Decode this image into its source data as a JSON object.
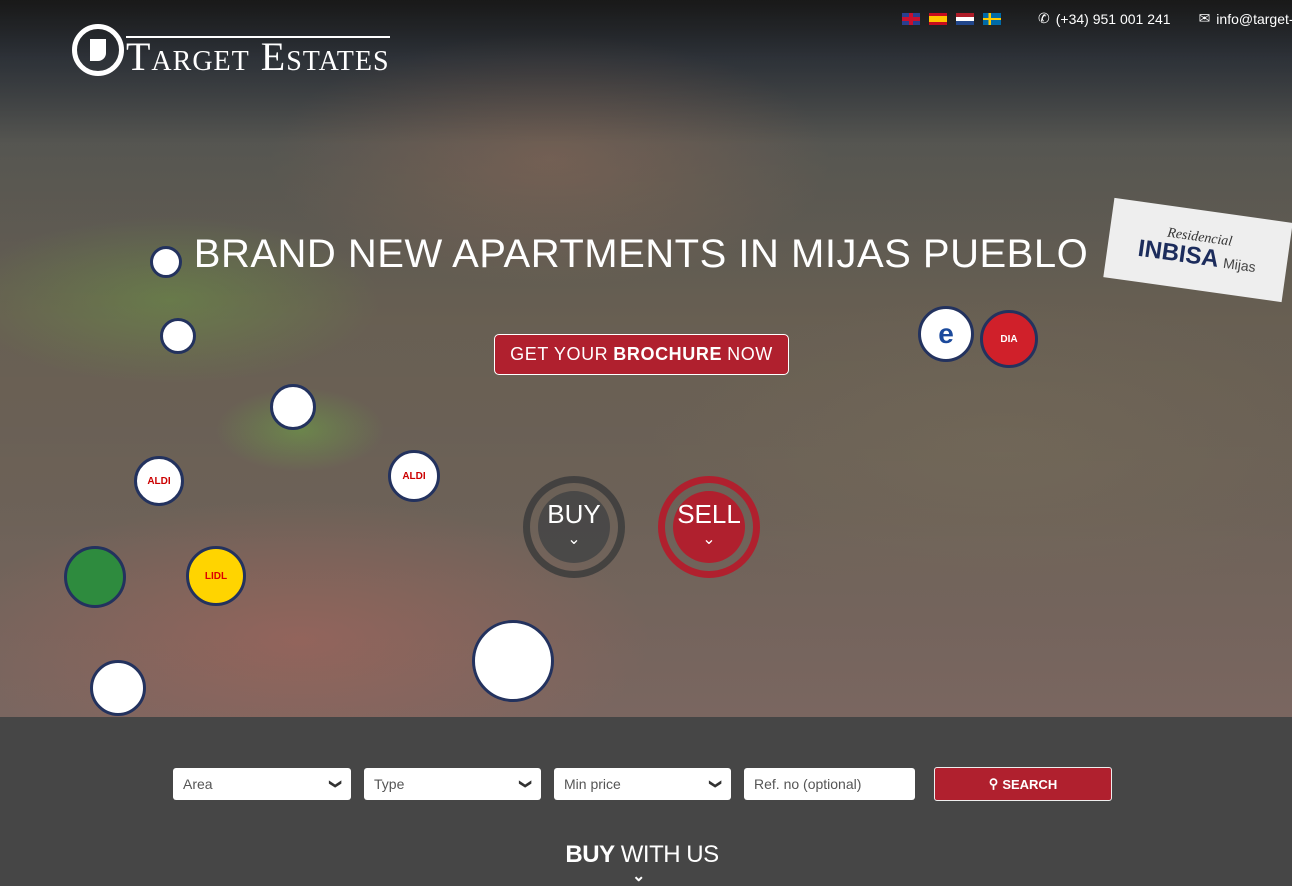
{
  "brand": {
    "name": "Target Estates"
  },
  "topbar": {
    "languages": [
      "English",
      "Español",
      "Nederlands",
      "Svenska"
    ],
    "phone": "(+34) 951 001 241",
    "email": "info@target-"
  },
  "hero": {
    "headline": "BRAND NEW APARTMENTS IN MIJAS PUEBLO",
    "cta": {
      "pre": "GET YOUR",
      "bold": "BROCHURE",
      "post": "NOW"
    },
    "buy_label": "BUY",
    "sell_label": "SELL",
    "sign": {
      "script": "Residencial",
      "name": "INBISA",
      "sub": "Mijas"
    },
    "map_labels": [
      "ALDI",
      "ALDI",
      "LIDL",
      "DIA"
    ]
  },
  "search": {
    "area": "Area",
    "type": "Type",
    "min_price": "Min price",
    "ref_placeholder": "Ref. no (optional)",
    "button": "SEARCH"
  },
  "section": {
    "bold": "BUY",
    "rest": "WITH US"
  },
  "colors": {
    "accent": "#b0202e",
    "section_bg": "#464646"
  }
}
